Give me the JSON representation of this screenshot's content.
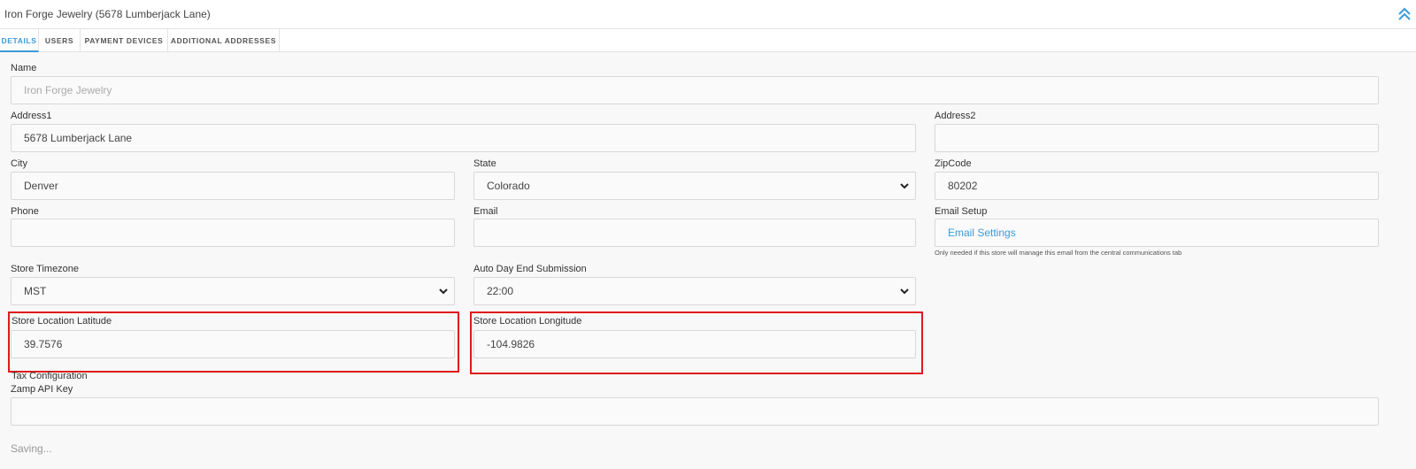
{
  "header": {
    "title": "Iron Forge Jewelry (5678 Lumberjack Lane)",
    "collapse_icon": "double-chevron-up-icon"
  },
  "tabs": [
    {
      "label": "DETAILS",
      "active": true
    },
    {
      "label": "USERS",
      "active": false
    },
    {
      "label": "PAYMENT DEVICES",
      "active": false
    },
    {
      "label": "ADDITIONAL ADDRESSES",
      "active": false
    }
  ],
  "form": {
    "name": {
      "label": "Name",
      "placeholder": "Iron Forge Jewelry"
    },
    "address1": {
      "label": "Address1",
      "value": "5678 Lumberjack Lane"
    },
    "address2": {
      "label": "Address2",
      "value": ""
    },
    "city": {
      "label": "City",
      "value": "Denver"
    },
    "state": {
      "label": "State",
      "value": "Colorado"
    },
    "zipcode": {
      "label": "ZipCode",
      "value": "80202"
    },
    "phone": {
      "label": "Phone",
      "value": ""
    },
    "email": {
      "label": "Email",
      "value": ""
    },
    "email_setup": {
      "label": "Email Setup",
      "link": "Email Settings",
      "hint": "Only needed if this store will manage this email from the central communications tab"
    },
    "timezone": {
      "label": "Store Timezone",
      "value": "MST"
    },
    "day_end": {
      "label": "Auto Day End Submission",
      "value": "22:00"
    },
    "latitude": {
      "label": "Store Location Latitude",
      "value": "39.7576"
    },
    "longitude": {
      "label": "Store Location Longitude",
      "value": "-104.9826"
    },
    "tax": {
      "label": "Tax Configuration"
    },
    "zamp": {
      "label": "Zamp API Key",
      "value": ""
    }
  },
  "status": {
    "saving": "Saving..."
  },
  "colors": {
    "accent": "#3a9ad9",
    "highlight": "#e01a1a"
  }
}
